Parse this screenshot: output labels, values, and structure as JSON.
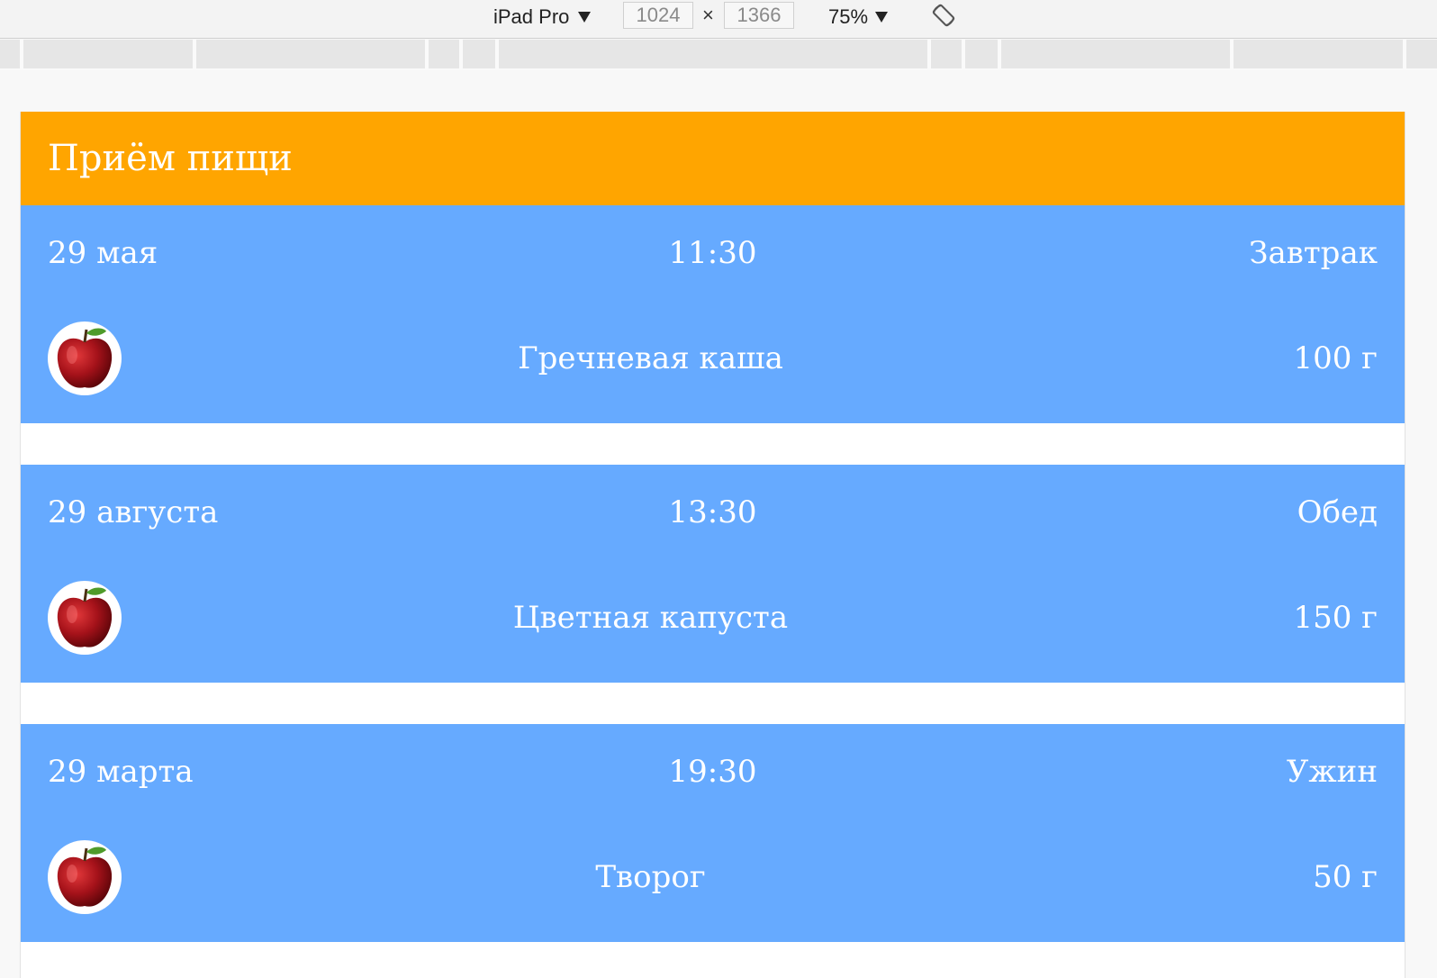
{
  "devtools": {
    "device": "iPad Pro",
    "width": "1024",
    "height": "1366",
    "times": "×",
    "zoom": "75%"
  },
  "app": {
    "title": "Приём пищи"
  },
  "meals": [
    {
      "date": "29 мая",
      "time": "11:30",
      "type": "Завтрак",
      "food": "Гречневая каша",
      "amount": "100 г",
      "image": "apple-icon"
    },
    {
      "date": "29 августа",
      "time": "13:30",
      "type": "Обед",
      "food": "Цветная капуста",
      "amount": "150 г",
      "image": "apple-icon"
    },
    {
      "date": "29 марта",
      "time": "19:30",
      "type": "Ужин",
      "food": "Творог",
      "amount": "50 г",
      "image": "apple-icon"
    }
  ],
  "colors": {
    "header": "#ffa500",
    "card": "#66aaff",
    "text": "#ffffff"
  }
}
